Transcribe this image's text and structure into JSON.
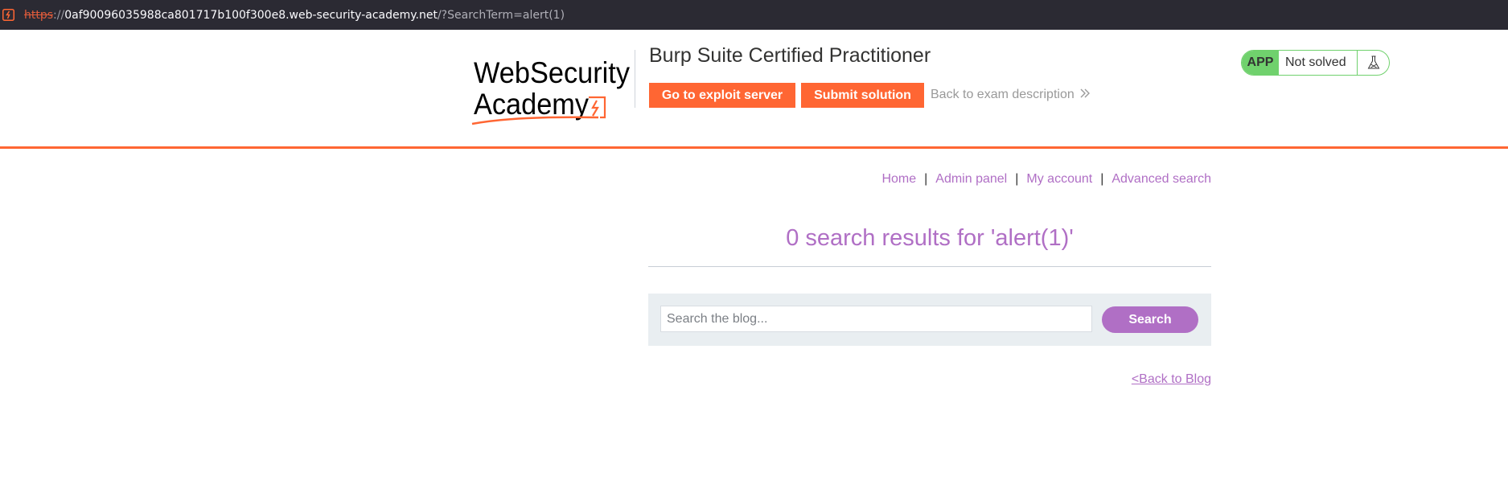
{
  "browser": {
    "url_scheme": "https",
    "url_separator": "://",
    "url_host": "0af90096035988ca801717b100f300e8.web-security-academy.net",
    "url_path": "/?SearchTerm=alert(1)",
    "site_icon": "lab-favicon-icon"
  },
  "header": {
    "logo_line1": "WebSecurity",
    "logo_line2": "Academy",
    "lab_title": "Burp Suite Certified Practitioner",
    "exploit_button": "Go to exploit server",
    "submit_button": "Submit solution",
    "back_link": "Back to exam description",
    "status_app": "APP",
    "status_text": "Not solved",
    "accent_color": "#ff6633",
    "status_color": "#70d16d"
  },
  "nav": {
    "items": [
      "Home",
      "Admin panel",
      "My account",
      "Advanced search"
    ],
    "separator": "|"
  },
  "results": {
    "title": "0 search results for 'alert(1)'"
  },
  "search": {
    "placeholder": "Search the blog...",
    "value": "",
    "button": "Search"
  },
  "footer": {
    "back_to_blog": "<Back to Blog"
  },
  "colors": {
    "link_purple": "#b06fc5",
    "panel_bg": "#e9eef1"
  }
}
